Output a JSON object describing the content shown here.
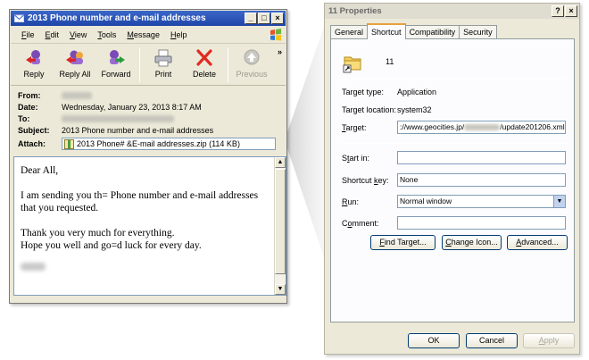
{
  "mail": {
    "title": "2013 Phone number and e-mail addresses",
    "window_buttons": [
      "_",
      "□",
      "×"
    ],
    "menu": [
      {
        "label": "File",
        "u": "F",
        "rest": "ile"
      },
      {
        "label": "Edit",
        "u": "E",
        "rest": "dit"
      },
      {
        "label": "View",
        "u": "V",
        "rest": "iew"
      },
      {
        "label": "Tools",
        "u": "T",
        "rest": "ools"
      },
      {
        "label": "Message",
        "u": "M",
        "rest": "essage"
      },
      {
        "label": "Help",
        "u": "H",
        "rest": "elp"
      }
    ],
    "toolbar": {
      "reply": "Reply",
      "reply_all": "Reply All",
      "forward": "Forward",
      "print": "Print",
      "delete": "Delete",
      "previous": "Previous",
      "more": "»"
    },
    "headers": {
      "from_label": "From:",
      "date_label": "Date:",
      "date_value": "Wednesday, January 23, 2013 8:17 AM",
      "to_label": "To:",
      "subject_label": "Subject:",
      "subject_value": "2013 Phone number and e-mail addresses",
      "attach_label": "Attach:",
      "attach_value": "2013 Phone# &E-mail addresses.zip (114 KB)"
    },
    "body": {
      "greeting": "Dear All,",
      "line1": "I am sending you th= Phone number and e-mail addresses that you requested.",
      "line2": "Thank you very much for everything.",
      "line3": "Hope you well and go=d luck for every day."
    }
  },
  "props": {
    "title": "11 Properties",
    "title_buttons": [
      "?",
      "×"
    ],
    "tabs": [
      "General",
      "Shortcut",
      "Compatibility",
      "Security"
    ],
    "name": "11",
    "target_type_label": "Target type:",
    "target_type_value": "Application",
    "target_location_label": "Target location:",
    "target_location_value": "system32",
    "target_label_u": "T",
    "target_label_rest": "arget:",
    "target_value_a": "://www.geocities.jp/",
    "target_value_b": "/update201206.xml",
    "start_in_label_a": "S",
    "start_in_label_u": "t",
    "start_in_label_rest": "art in:",
    "start_in_value": "",
    "shortcut_key_label_a": "Shortcut ",
    "shortcut_key_label_u": "k",
    "shortcut_key_label_rest": "ey:",
    "shortcut_key_value": "None",
    "run_label_u": "R",
    "run_label_rest": "un:",
    "run_value": "Normal window",
    "comment_label_a": "C",
    "comment_label_u": "o",
    "comment_label_rest": "mment:",
    "comment_value": "",
    "find_target_u": "F",
    "find_target_rest": "ind Target...",
    "change_icon_a": "",
    "change_icon_u": "C",
    "change_icon_rest": "hange Icon...",
    "advanced_u": "A",
    "advanced_rest": "dvanced...",
    "ok": "OK",
    "cancel": "Cancel",
    "apply_u": "A",
    "apply_rest": "pply"
  }
}
